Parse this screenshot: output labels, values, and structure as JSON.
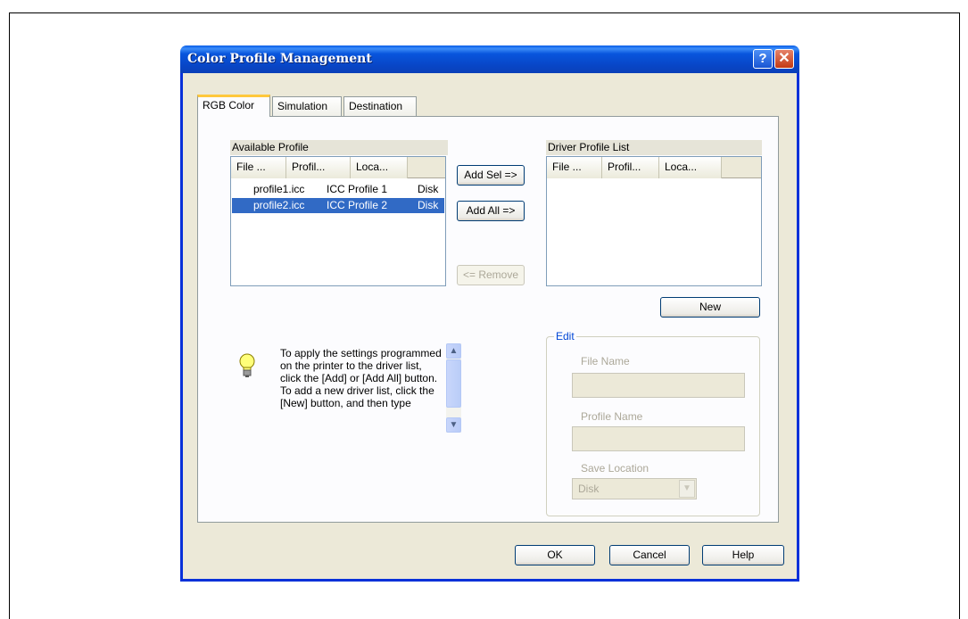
{
  "dialog": {
    "title": "Color Profile Management",
    "help_glyph": "?",
    "close_glyph": "✕"
  },
  "tabs": [
    {
      "label": "RGB Color",
      "active": true
    },
    {
      "label": "Simulation",
      "active": false
    },
    {
      "label": "Destination",
      "active": false
    }
  ],
  "available_profile": {
    "label": "Available Profile",
    "columns": [
      "File ...",
      "Profil...",
      "Loca..."
    ],
    "rows": [
      {
        "file": "profile1.icc",
        "profile": "ICC Profile 1",
        "location": "Disk",
        "selected": false
      },
      {
        "file": "profile2.icc",
        "profile": "ICC Profile 2",
        "location": "Disk",
        "selected": true
      }
    ]
  },
  "driver_profile": {
    "label": "Driver Profile List",
    "columns": [
      "File ...",
      "Profil...",
      "Loca..."
    ]
  },
  "buttons": {
    "add_sel": "Add Sel =>",
    "add_all": "Add All =>",
    "remove": "<= Remove",
    "new": "New",
    "ok": "OK",
    "cancel": "Cancel",
    "help": "Help"
  },
  "hint": {
    "text": "To apply the settings programmed on the printer to the driver list, click the [Add] or [Add All] button. To add a new driver list, click the [New] button, and then type",
    "icon": "lightbulb-icon"
  },
  "edit": {
    "legend": "Edit",
    "file_name_label": "File Name",
    "file_name_value": "",
    "profile_name_label": "Profile Name",
    "profile_name_value": "",
    "save_location_label": "Save Location",
    "save_location_value": "Disk"
  },
  "colors": {
    "titlebar": "#0855dd",
    "selection": "#316ac5",
    "dialog_bg": "#ece9d8",
    "tab_highlight": "#ffc83c"
  }
}
